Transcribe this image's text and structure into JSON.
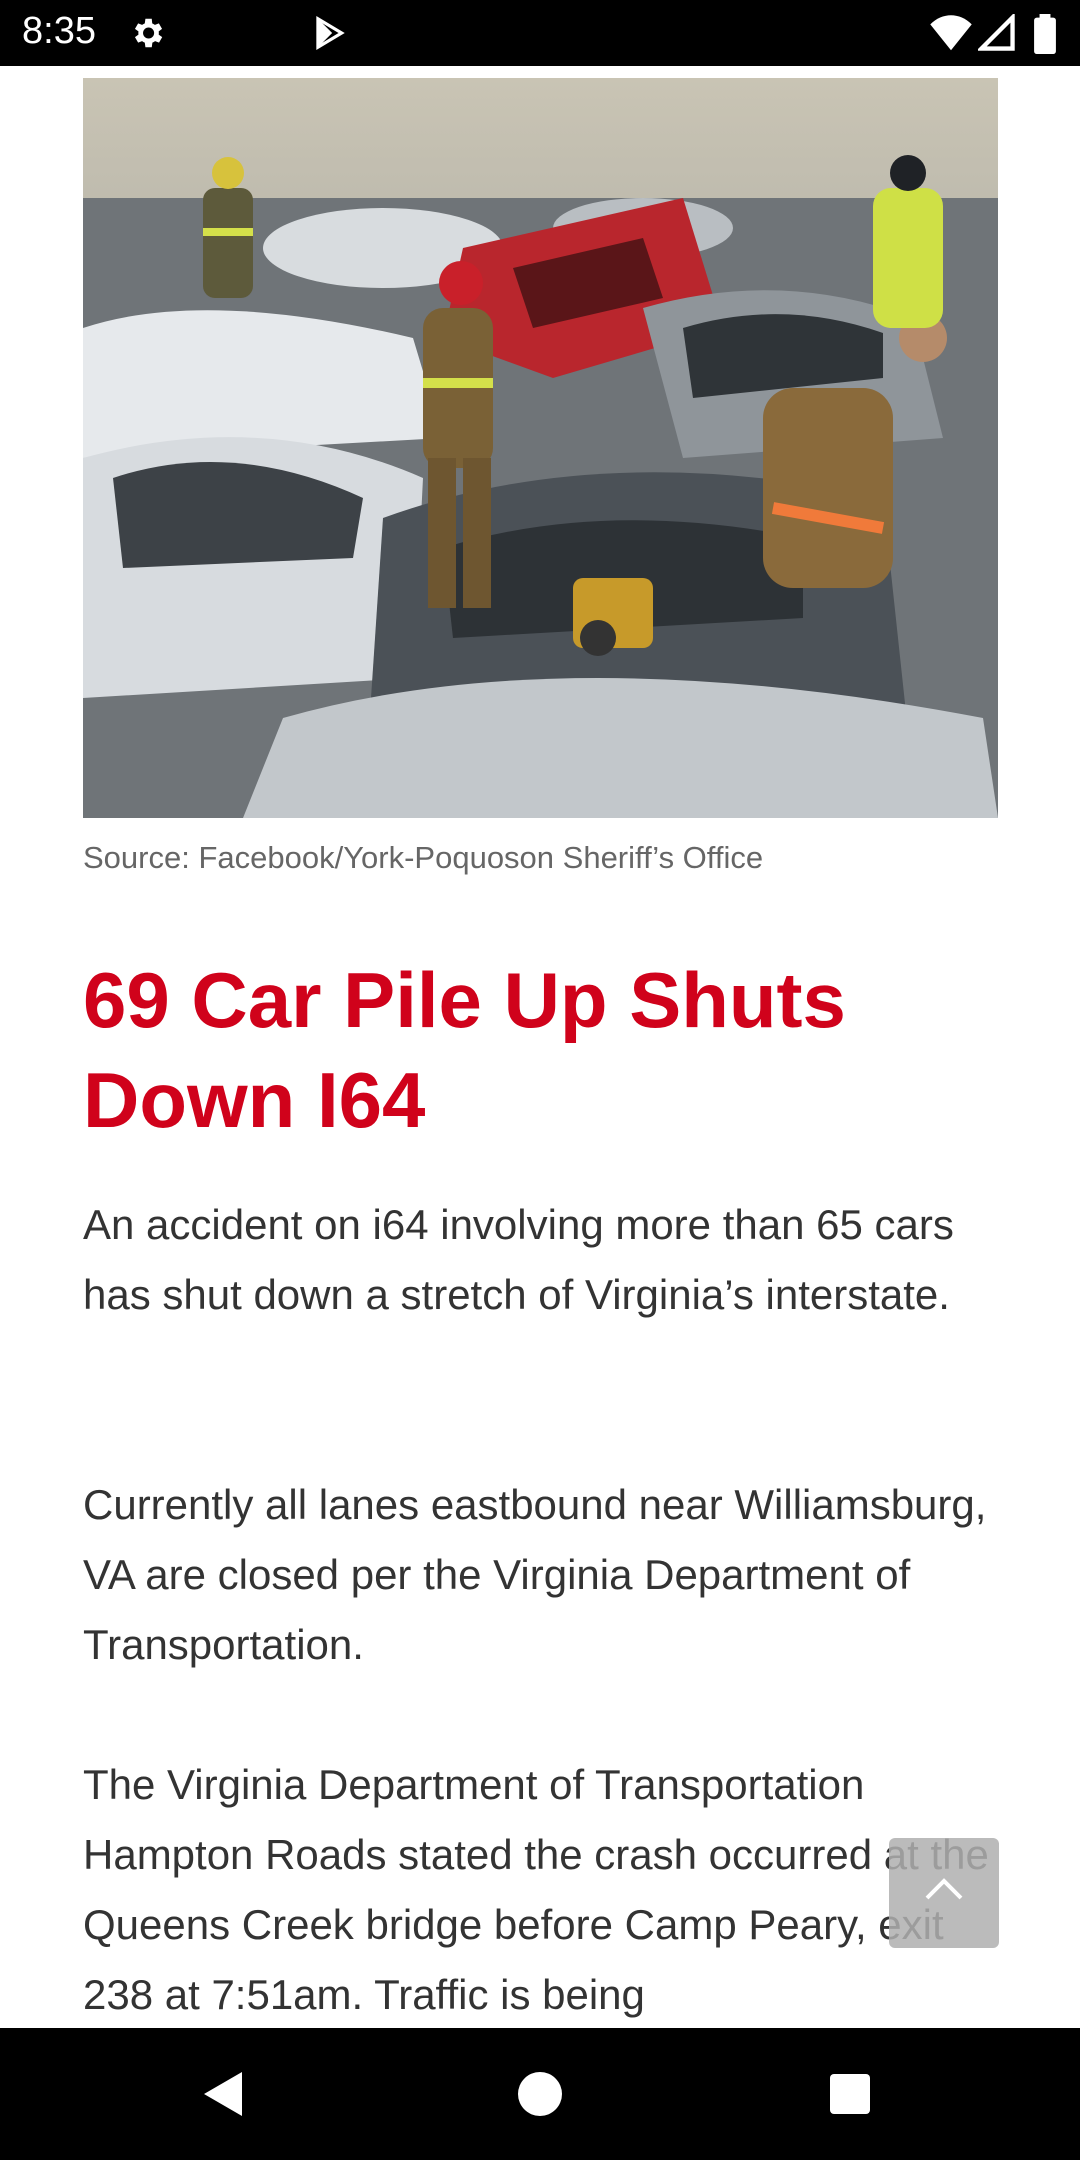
{
  "status_bar": {
    "time": "8:35",
    "icons": [
      "gear-icon",
      "play-store-icon",
      "wifi-icon",
      "signal-icon",
      "battery-icon"
    ]
  },
  "article": {
    "photo_alt": "",
    "caption": "Source: Facebook/York-Poquoson Sheriff’s Office",
    "title": "69 Car Pile Up Shuts Down I64",
    "paragraphs": [
      "An accident on i64 involving more than 65 cars has shut down a stretch of Virginia’s interstate.",
      "Currently all lanes eastbound near Williamsburg, VA are closed per the Virginia Department of Transportation.",
      "The Virginia Department of Transportation Hampton Roads stated the crash occurred at the Queens Creek bridge before Camp Peary, exit 238 at 7:51am. Traffic is being"
    ],
    "colors": {
      "headline": "#d0021b",
      "body": "#333333",
      "caption": "#666666"
    }
  },
  "controls": {
    "back_to_top_icon": "chevron-up-icon"
  },
  "nav_bar": {
    "buttons": [
      "back-icon",
      "home-icon",
      "recents-icon"
    ]
  }
}
